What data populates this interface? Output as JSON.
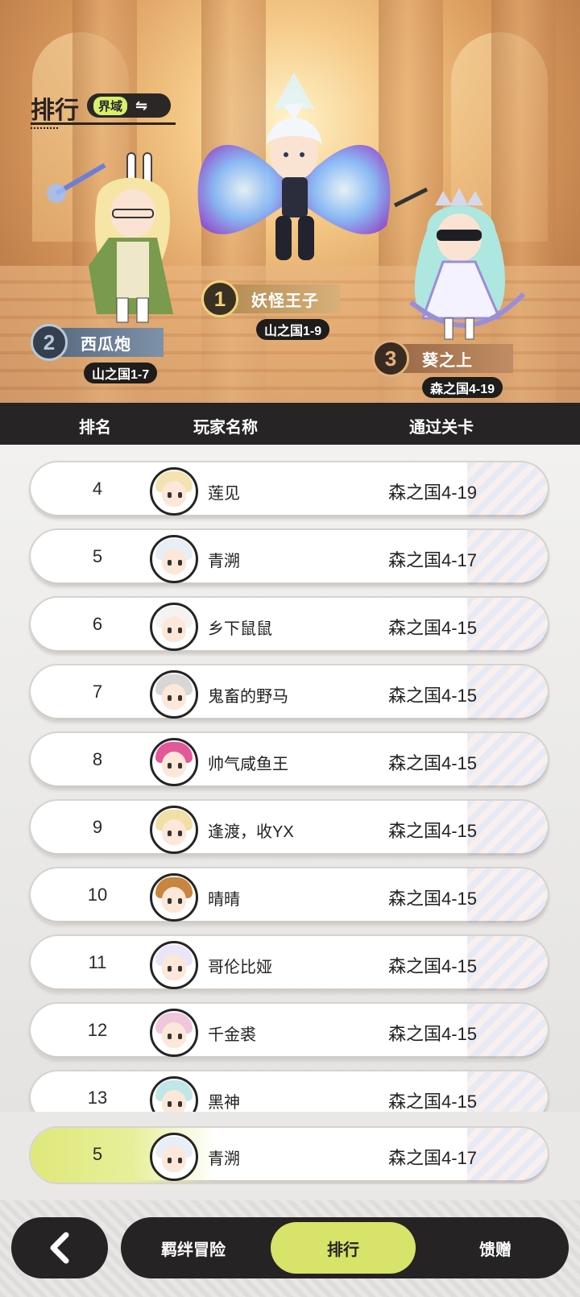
{
  "header": {
    "title": "排行",
    "realm_label": "界域",
    "switch_icon": "⇋"
  },
  "podium": {
    "first": {
      "rank": "1",
      "name": "妖怪王子",
      "stage": "山之国1-9"
    },
    "second": {
      "rank": "2",
      "name": "西瓜炮",
      "stage": "山之国1-7"
    },
    "third": {
      "rank": "3",
      "name": "葵之上",
      "stage": "森之国4-19"
    }
  },
  "table": {
    "columns": [
      "排名",
      "玩家名称",
      "通过关卡"
    ],
    "rows": [
      {
        "rank": "4",
        "name": "莲见",
        "stage": "森之国4-19"
      },
      {
        "rank": "5",
        "name": "青溯",
        "stage": "森之国4-17"
      },
      {
        "rank": "6",
        "name": "乡下鼠鼠",
        "stage": "森之国4-15"
      },
      {
        "rank": "7",
        "name": "鬼畜的野马",
        "stage": "森之国4-15"
      },
      {
        "rank": "8",
        "name": "帅气咸鱼王",
        "stage": "森之国4-15"
      },
      {
        "rank": "9",
        "name": "逢渡，收YX",
        "stage": "森之国4-15"
      },
      {
        "rank": "10",
        "name": "晴晴",
        "stage": "森之国4-15"
      },
      {
        "rank": "11",
        "name": "哥伦比娅",
        "stage": "森之国4-15"
      },
      {
        "rank": "12",
        "name": "千金裘",
        "stage": "森之国4-15"
      },
      {
        "rank": "13",
        "name": "黑神",
        "stage": "森之国4-15"
      }
    ]
  },
  "my_rank": {
    "rank": "5",
    "name": "青溯",
    "stage": "森之国4-17"
  },
  "nav": {
    "back_icon": "‹",
    "tabs": [
      "羁绊冒险",
      "排行",
      "馈赠"
    ],
    "active_tab": "排行"
  },
  "colors": {
    "accent": "#d8e36a",
    "dark": "#252323",
    "gold_badge": "#f2d27a",
    "silver_badge": "#b9c7d8",
    "bronze_badge": "#e2b27d"
  }
}
